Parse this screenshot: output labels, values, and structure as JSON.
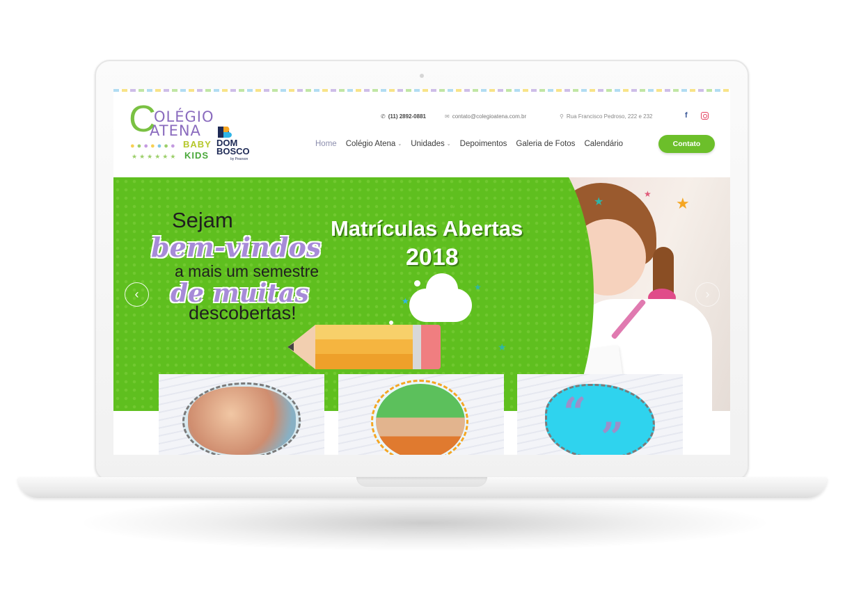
{
  "header": {
    "logo": {
      "brand_initial": "C",
      "brand_line1": "OLÉGIO",
      "brand_line2": "ATENA",
      "baby": "BABY",
      "kids": "KIDS",
      "partner_line1": "DOM",
      "partner_line2": "BOSCO",
      "partner_sub": "by Pearson"
    },
    "topbar": {
      "phone": "(11) 2892-0881",
      "email": "contato@colegioatena.com.br",
      "address": "Rua Francisco Pedroso, 222 e 232"
    },
    "nav": [
      {
        "label": "Home",
        "active": true,
        "dropdown": false
      },
      {
        "label": "Colégio Atena",
        "active": false,
        "dropdown": true
      },
      {
        "label": "Unidades",
        "active": false,
        "dropdown": true
      },
      {
        "label": "Depoimentos",
        "active": false,
        "dropdown": false
      },
      {
        "label": "Galeria de Fotos",
        "active": false,
        "dropdown": false
      },
      {
        "label": "Calendário",
        "active": false,
        "dropdown": false
      }
    ],
    "contact_button": "Contato"
  },
  "hero": {
    "line1": "Sejam",
    "line2": "bem-vindos",
    "line3": "a mais um semestre",
    "line4": "de muitas",
    "line5": "descobertas!",
    "headline": "Matrículas Abertas",
    "year": "2018",
    "prev_icon": "‹",
    "next_icon": "›"
  },
  "cards": [
    {
      "name": "kids-playing-photo"
    },
    {
      "name": "kids-in-boat-photo"
    },
    {
      "name": "testimonials-quote"
    }
  ],
  "quote_open": "“",
  "quote_close": "”",
  "icons": {
    "phone": "phone-icon",
    "email": "envelope-icon",
    "address": "map-pin-icon",
    "facebook": "facebook-icon",
    "instagram": "instagram-icon"
  },
  "colors": {
    "brand_green": "#6cbf2a",
    "brand_purple": "#8a6bbe",
    "hero_green": "#5fbf1f",
    "nav_active": "#8d8fae"
  }
}
